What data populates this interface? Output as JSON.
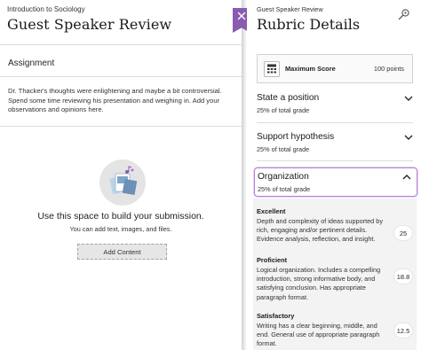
{
  "left": {
    "course": "Introduction to Sociology",
    "title": "Guest Speaker Review",
    "section_label": "Assignment",
    "instructions": "Dr. Thacker's thoughts were enlightening and maybe a bit controversial. Spend some time reviewing his presentation and weighing in. Add your observations and opinions here.",
    "cta_title": "Use this space to build your submission.",
    "cta_subtitle": "You can add text, images, and files.",
    "add_button": "Add Content"
  },
  "right": {
    "crumb": "Guest Speaker Review",
    "title": "Rubric Details",
    "max_score_label": "Maximum Score",
    "max_score_value": "100 points",
    "criteria": [
      {
        "name": "State a position",
        "pct": "25% of total grade",
        "expanded": false
      },
      {
        "name": "Support hypothesis",
        "pct": "25% of total grade",
        "expanded": false
      },
      {
        "name": "Organization",
        "pct": "25% of total grade",
        "expanded": true
      }
    ],
    "levels": [
      {
        "name": "Excellent",
        "desc": "Depth and complexity of ideas supported by rich, engaging and/or pertinent details. Evidence analysis, reflection, and insight.",
        "score": "25"
      },
      {
        "name": "Proficient",
        "desc": "Logical organization. Includes a compelling introduction, strong informative body, and satisfying conclusion. Has appropriate paragraph format.",
        "score": "18.8"
      },
      {
        "name": "Satisfactory",
        "desc": "Writing has a clear beginning, middle, and end. General use of appropriate paragraph format.",
        "score": "12.5"
      }
    ]
  },
  "colors": {
    "accent": "#8a5bb1",
    "selected_border": "#b77fd6"
  },
  "icons": {
    "close": "close-icon",
    "rubric_tool": "rubric-search-icon",
    "max_score": "calculator-icon",
    "chevron_down": "chevron-down-icon",
    "chevron_up": "chevron-up-icon",
    "illustration": "files-illustration-icon"
  }
}
